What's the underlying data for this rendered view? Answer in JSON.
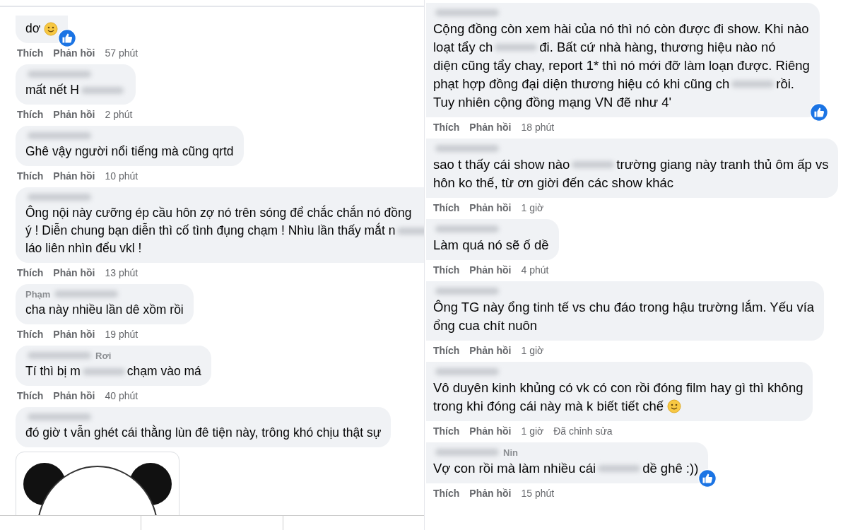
{
  "columns": [
    {
      "comments": [
        {
          "lines": [
            [
              {
                "kind": "text",
                "text": "dơ "
              },
              {
                "kind": "emoji"
              }
            ]
          ],
          "reaction": true,
          "meta": {
            "like": "Thích",
            "reply": "Phản hồi",
            "time": "57 phút"
          }
        },
        {
          "name": [
            {
              "kind": "blur"
            }
          ],
          "lines": [
            [
              {
                "kind": "text",
                "text": "mất nết H"
              },
              {
                "kind": "blur"
              }
            ]
          ],
          "reaction": false,
          "meta": {
            "like": "Thích",
            "reply": "Phản hồi",
            "time": "2 phút"
          }
        },
        {
          "name": [
            {
              "kind": "blur"
            }
          ],
          "lines": [
            [
              {
                "kind": "text",
                "text": "Ghê vậy người nổi tiếng mà cũng qrtd"
              }
            ]
          ],
          "reaction": false,
          "meta": {
            "like": "Thích",
            "reply": "Phản hồi",
            "time": "10 phút"
          }
        },
        {
          "name": [
            {
              "kind": "blur"
            }
          ],
          "lines": [
            [
              {
                "kind": "text",
                "text": "Ông nội này cưỡng ép cầu hôn zợ nó trên sóng để chắc chắn nó đồng"
              }
            ],
            [
              {
                "kind": "text",
                "text": "ý ! Diễn chung bạn diễn thì cố tình đụng chạm ! Nhìu lần thấy mắt n"
              },
              {
                "kind": "blur"
              }
            ],
            [
              {
                "kind": "text",
                "text": "láo liên nhìn đểu vkl !"
              }
            ]
          ],
          "reaction": false,
          "meta": {
            "like": "Thích",
            "reply": "Phản hồi",
            "time": "13 phút"
          }
        },
        {
          "name": [
            {
              "kind": "text",
              "text": "Phạm"
            },
            {
              "kind": "blur"
            }
          ],
          "lines": [
            [
              {
                "kind": "text",
                "text": "cha này nhiều lần dê xồm rồi"
              }
            ]
          ],
          "reaction": false,
          "meta": {
            "like": "Thích",
            "reply": "Phản hồi",
            "time": "19 phút"
          }
        },
        {
          "name": [
            {
              "kind": "blur"
            },
            {
              "kind": "text",
              "text": "Rơi"
            }
          ],
          "lines": [
            [
              {
                "kind": "text",
                "text": "Tí thì bị m"
              },
              {
                "kind": "blur"
              },
              {
                "kind": "text",
                "text": "chạm vào má"
              }
            ]
          ],
          "reaction": false,
          "meta": {
            "like": "Thích",
            "reply": "Phản hồi",
            "time": "40 phút"
          }
        },
        {
          "name": [
            {
              "kind": "blur"
            }
          ],
          "lines": [
            [
              {
                "kind": "text",
                "text": "đó giờ t vẫn ghét cái thằng lùn đê tiện này, trông khó chịu thật sự"
              }
            ]
          ],
          "reaction": false,
          "attachment": {
            "kind": "sticker"
          }
        }
      ]
    },
    {
      "comments": [
        {
          "name": [
            {
              "kind": "blur"
            }
          ],
          "lines": [
            [
              {
                "kind": "text",
                "text": "Cộng đồng còn xem hài của nó thì nó còn được đi show. Khi nào"
              }
            ],
            [
              {
                "kind": "text",
                "text": "loạt tẩy ch"
              },
              {
                "kind": "blur"
              },
              {
                "kind": "text",
                "text": "đi. Bất cứ nhà hàng, thương hiệu nào nó"
              }
            ],
            [
              {
                "kind": "text",
                "text": "diện cũng tẩy chay, report 1* thì nó mới đỡ làm loạn được. Riêng"
              }
            ],
            [
              {
                "kind": "text",
                "text": "phạt hợp đồng đại diện thương hiệu có khi cũng ch"
              },
              {
                "kind": "blur"
              },
              {
                "kind": "text",
                "text": "rồi."
              }
            ],
            [
              {
                "kind": "text",
                "text": "Tuy nhiên cộng đồng mạng VN đẽ như 4'"
              }
            ]
          ],
          "reaction": true,
          "meta": {
            "like": "Thích",
            "reply": "Phản hồi",
            "time": "18 phút"
          }
        },
        {
          "name": [
            {
              "kind": "blur"
            }
          ],
          "lines": [
            [
              {
                "kind": "text",
                "text": "sao t thấy cái show nào"
              },
              {
                "kind": "blur"
              },
              {
                "kind": "text",
                "text": "trường giang này tranh thủ ôm ấp vs"
              }
            ],
            [
              {
                "kind": "text",
                "text": "hôn ko thế, từ ơn giời đến các show khác"
              }
            ]
          ],
          "reaction": false,
          "meta": {
            "like": "Thích",
            "reply": "Phản hồi",
            "time": "1 giờ"
          }
        },
        {
          "name": [
            {
              "kind": "blur"
            }
          ],
          "lines": [
            [
              {
                "kind": "text",
                "text": "Làm quá nó sẽ ố dề"
              }
            ]
          ],
          "reaction": false,
          "meta": {
            "like": "Thích",
            "reply": "Phản hồi",
            "time": "4 phút"
          }
        },
        {
          "name": [
            {
              "kind": "blur"
            }
          ],
          "lines": [
            [
              {
                "kind": "text",
                "text": "Ông TG này ổng tinh tế vs chu đáo trong hậu trường lắm. Yếu vía"
              }
            ],
            [
              {
                "kind": "text",
                "text": "ổng cua chít nuôn"
              }
            ]
          ],
          "reaction": false,
          "meta": {
            "like": "Thích",
            "reply": "Phản hồi",
            "time": "1 giờ"
          }
        },
        {
          "name": [
            {
              "kind": "blur"
            }
          ],
          "lines": [
            [
              {
                "kind": "text",
                "text": "Vô duyên kinh khủng có vk có con rồi đóng film hay gì thì không"
              }
            ],
            [
              {
                "kind": "text",
                "text": "trong khi đóng cái này mà k biết tiết chế "
              },
              {
                "kind": "emoji"
              }
            ]
          ],
          "reaction": false,
          "meta": {
            "like": "Thích",
            "reply": "Phản hồi",
            "time": "1 giờ",
            "edited": "Đã chỉnh sửa"
          }
        },
        {
          "name": [
            {
              "kind": "blur"
            },
            {
              "kind": "text",
              "text": "Nin"
            }
          ],
          "lines": [
            [
              {
                "kind": "text",
                "text": "Vợ con rồi mà làm nhiều cái"
              },
              {
                "kind": "blur"
              },
              {
                "kind": "text",
                "text": "dề ghê :))"
              }
            ]
          ],
          "reaction": true,
          "meta": {
            "like": "Thích",
            "reply": "Phản hồi",
            "time": "15 phút"
          }
        }
      ]
    }
  ]
}
